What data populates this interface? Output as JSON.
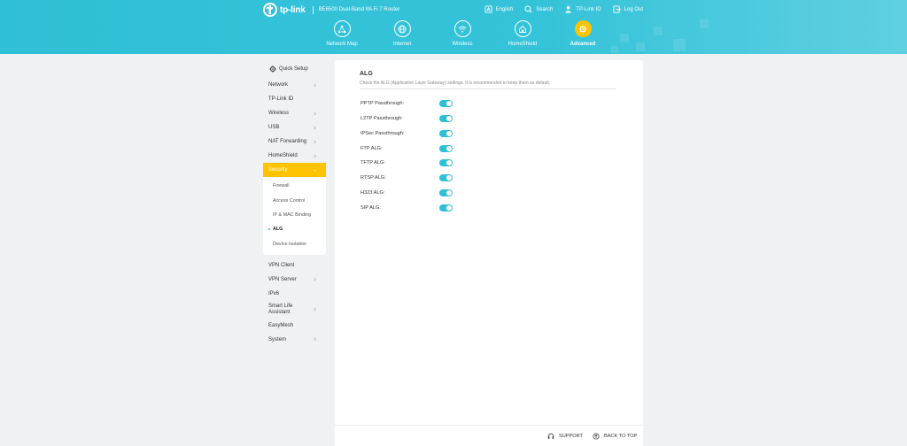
{
  "header": {
    "logo_text": "tp-link",
    "model": "BE6500 Dual-Band Wi-Fi 7 Router",
    "links": [
      {
        "label": "English",
        "icon": "language-icon"
      },
      {
        "label": "Search",
        "icon": "search-icon"
      },
      {
        "label": "TP-Link ID",
        "icon": "user-icon"
      },
      {
        "label": "Log Out",
        "icon": "logout-icon"
      }
    ]
  },
  "nav": [
    {
      "label": "Network Map",
      "icon": "network-map-icon"
    },
    {
      "label": "Internet",
      "icon": "globe-icon"
    },
    {
      "label": "Wireless",
      "icon": "wifi-icon"
    },
    {
      "label": "HomeShield",
      "icon": "home-shield-icon"
    },
    {
      "label": "Advanced",
      "icon": "gear-icon",
      "active": true
    }
  ],
  "sidebar": {
    "quick_setup": "Quick Setup",
    "items": [
      {
        "label": "Network"
      },
      {
        "label": "TP-Link ID"
      },
      {
        "label": "Wireless"
      },
      {
        "label": "USB"
      },
      {
        "label": "NAT Forwarding"
      },
      {
        "label": "HomeShield"
      },
      {
        "label": "Security"
      },
      {
        "label": "VPN Client"
      },
      {
        "label": "VPN Server"
      },
      {
        "label": "IPv6"
      },
      {
        "label": "Smart Life Assistant"
      },
      {
        "label": "EasyMesh"
      },
      {
        "label": "System"
      }
    ],
    "security_sub": [
      {
        "label": "Firewall"
      },
      {
        "label": "Access Control"
      },
      {
        "label": "IP & MAC Binding"
      },
      {
        "label": "ALG"
      },
      {
        "label": "Device Isolation"
      }
    ]
  },
  "main": {
    "title": "ALG",
    "description": "Check the ALG (Application Layer Gateway) settings. It is recommended to keep them as default.",
    "settings": [
      {
        "label": "PPTP Passthrough:",
        "enabled": true
      },
      {
        "label": "L2TP Passthrough:",
        "enabled": true
      },
      {
        "label": "IPSec Passthrough:",
        "enabled": true
      },
      {
        "label": "FTP ALG:",
        "enabled": true
      },
      {
        "label": "TFTP ALG:",
        "enabled": true
      },
      {
        "label": "RTSP ALG:",
        "enabled": true
      },
      {
        "label": "H323 ALG:",
        "enabled": true
      },
      {
        "label": "SIP ALG:",
        "enabled": true
      }
    ]
  },
  "footer": {
    "support": "SUPPORT",
    "back_to_top": "BACK TO TOP"
  },
  "colors": {
    "header": "#2fbfd6",
    "accent": "#ffc300",
    "toggle_on": "#2fbfd6"
  }
}
